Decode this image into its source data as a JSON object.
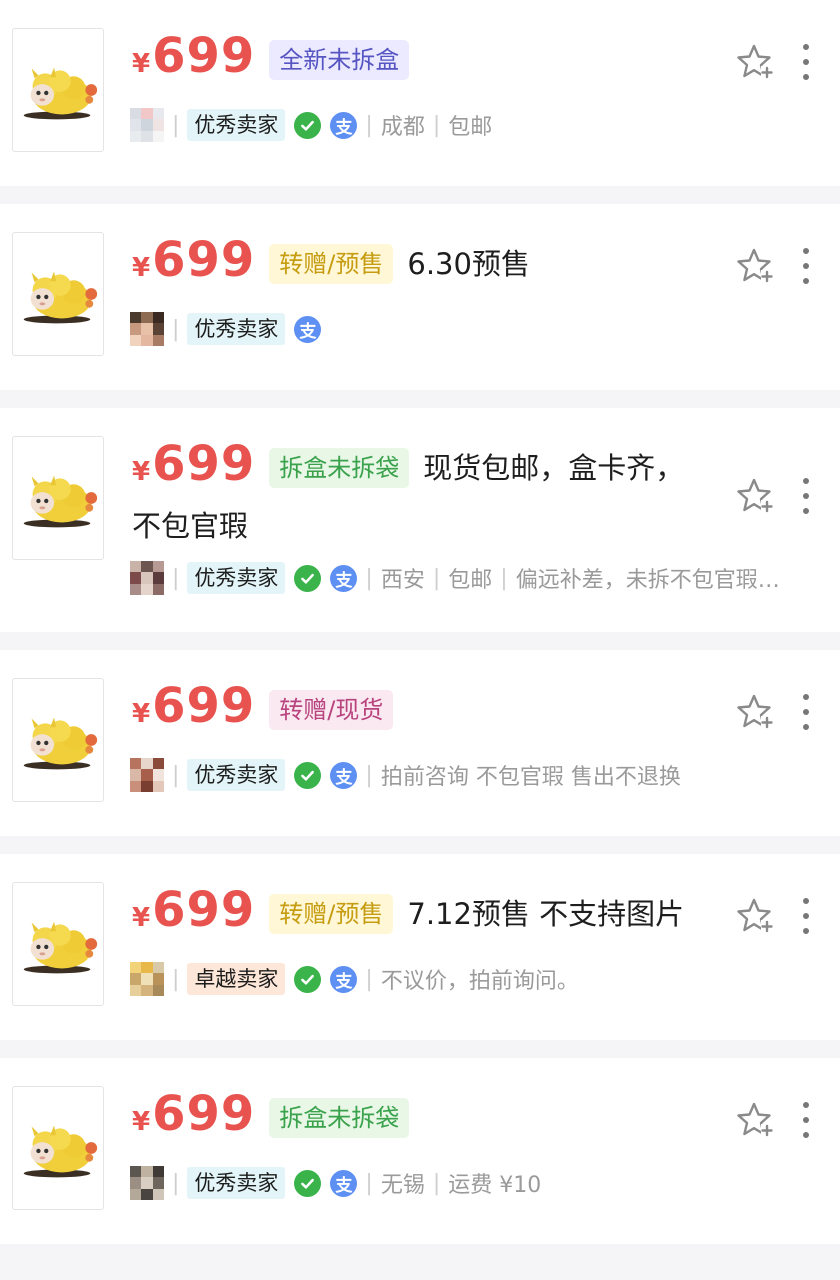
{
  "currency": "¥",
  "listings": [
    {
      "price": "699",
      "tag": "全新未拆盒",
      "tag_color": "blue",
      "title": "",
      "badge": "优秀卖家",
      "badge_color": "teal",
      "wechat_pay": true,
      "alipay": true,
      "meta": [
        "成都",
        "包邮"
      ],
      "avatar": [
        "#d9dde3",
        "#f2c7c8",
        "#e7e9ee",
        "#e1e4ea",
        "#cfd5dd",
        "#f0e3e3",
        "#e9ecef",
        "#dfe3e8",
        "#f5f5f6"
      ]
    },
    {
      "price": "699",
      "tag": "转赠/预售",
      "tag_color": "yellow",
      "title": "6.30预售",
      "badge": "优秀卖家",
      "badge_color": "teal",
      "wechat_pay": false,
      "alipay": true,
      "meta": [],
      "avatar": [
        "#4b3a2e",
        "#8d6a52",
        "#3a2a22",
        "#c79a80",
        "#e8c2a8",
        "#5a4234",
        "#f0d2bd",
        "#e3b7a0",
        "#a87c64"
      ]
    },
    {
      "price": "699",
      "tag": "拆盒未拆袋",
      "tag_color": "green",
      "title": "现货包邮，盒卡齐，不包官瑕",
      "badge": "优秀卖家",
      "badge_color": "teal",
      "wechat_pay": true,
      "alipay": true,
      "meta": [
        "西安",
        "包邮",
        "偏远补差，未拆不包官瑕…"
      ],
      "avatar": [
        "#c9b2a8",
        "#6d5550",
        "#b79a94",
        "#7c4a4a",
        "#d8c6bd",
        "#5c3b3d",
        "#a78c89",
        "#e5d4cc",
        "#8c6a66"
      ]
    },
    {
      "price": "699",
      "tag": "转赠/现货",
      "tag_color": "pink",
      "title": "",
      "badge": "优秀卖家",
      "badge_color": "teal",
      "wechat_pay": true,
      "alipay": true,
      "meta": [
        "拍前咨询 不包官瑕 售出不退换"
      ],
      "avatar": [
        "#b6745f",
        "#e7d6cc",
        "#8a4b3a",
        "#d9b8a8",
        "#a75e4a",
        "#f1e4dc",
        "#c98f7b",
        "#7a3e30",
        "#e3c8ba"
      ]
    },
    {
      "price": "699",
      "tag": "转赠/预售",
      "tag_color": "yellow",
      "title": "7.12预售 不支持图片",
      "badge": "卓越卖家",
      "badge_color": "orange",
      "wechat_pay": true,
      "alipay": true,
      "meta": [
        "不议价，拍前询问。"
      ],
      "avatar": [
        "#f2d37a",
        "#e8b94a",
        "#d8c9a8",
        "#c9a66a",
        "#f0e0b8",
        "#b89258",
        "#e6cf9a",
        "#d4b47c",
        "#a88a5a"
      ]
    },
    {
      "price": "699",
      "tag": "拆盒未拆袋",
      "tag_color": "green",
      "title": "",
      "badge": "优秀卖家",
      "badge_color": "teal",
      "wechat_pay": true,
      "alipay": true,
      "meta": [
        "无锡",
        "运费 ¥10"
      ],
      "avatar": [
        "#5c5650",
        "#bfb2a0",
        "#3f3a36",
        "#9a8f82",
        "#d8cfc2",
        "#6e655c",
        "#b4a898",
        "#4a4440",
        "#cfc5b8"
      ]
    }
  ]
}
